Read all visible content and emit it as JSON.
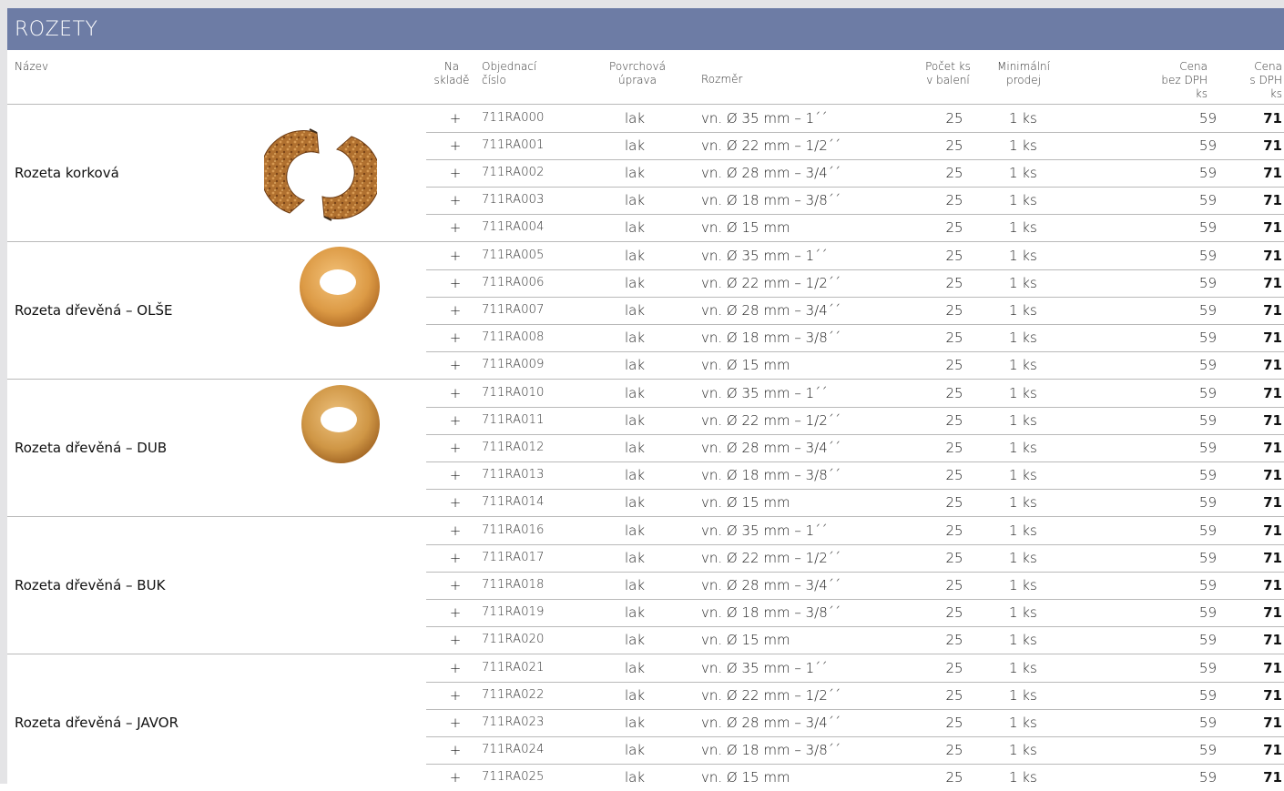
{
  "title": "ROZETY",
  "headers": {
    "name": "Název",
    "stock": [
      "Na",
      "skladě"
    ],
    "code": [
      "Objednací",
      "číslo"
    ],
    "finish": [
      "Povrchová",
      "úprava"
    ],
    "size": "Rozměr",
    "pack": [
      "Počet ks",
      "v balení"
    ],
    "min": [
      "Minimální",
      "prodej"
    ],
    "price": [
      "Cena",
      "bez DPH",
      "ks"
    ],
    "price_vat": [
      "Cena",
      "s DPH",
      "ks"
    ]
  },
  "groups": [
    {
      "name": "Rozeta korková",
      "image": "cork-rosette-image",
      "rows": [
        {
          "stock": "+",
          "code": "711RA000",
          "finish": "lak",
          "size": "vn. Ø 35 mm – 1´´",
          "pack": "25",
          "min": "1 ks",
          "price": "59",
          "price_vat": "71"
        },
        {
          "stock": "+",
          "code": "711RA001",
          "finish": "lak",
          "size": "vn. Ø 22 mm – 1/2´´",
          "pack": "25",
          "min": "1 ks",
          "price": "59",
          "price_vat": "71"
        },
        {
          "stock": "+",
          "code": "711RA002",
          "finish": "lak",
          "size": "vn. Ø 28 mm – 3/4´´",
          "pack": "25",
          "min": "1 ks",
          "price": "59",
          "price_vat": "71"
        },
        {
          "stock": "+",
          "code": "711RA003",
          "finish": "lak",
          "size": "vn. Ø 18 mm – 3/8´´",
          "pack": "25",
          "min": "1 ks",
          "price": "59",
          "price_vat": "71"
        },
        {
          "stock": "+",
          "code": "711RA004",
          "finish": "lak",
          "size": "vn. Ø 15 mm",
          "pack": "25",
          "min": "1 ks",
          "price": "59",
          "price_vat": "71"
        }
      ]
    },
    {
      "name": "Rozeta dřevěná – OLŠE",
      "image": "alder-rosette-image",
      "rows": [
        {
          "stock": "+",
          "code": "711RA005",
          "finish": "lak",
          "size": "vn. Ø 35 mm – 1´´",
          "pack": "25",
          "min": "1 ks",
          "price": "59",
          "price_vat": "71"
        },
        {
          "stock": "+",
          "code": "711RA006",
          "finish": "lak",
          "size": "vn. Ø 22 mm – 1/2´´",
          "pack": "25",
          "min": "1 ks",
          "price": "59",
          "price_vat": "71"
        },
        {
          "stock": "+",
          "code": "711RA007",
          "finish": "lak",
          "size": "vn. Ø 28 mm – 3/4´´",
          "pack": "25",
          "min": "1 ks",
          "price": "59",
          "price_vat": "71"
        },
        {
          "stock": "+",
          "code": "711RA008",
          "finish": "lak",
          "size": "vn. Ø 18 mm – 3/8´´",
          "pack": "25",
          "min": "1 ks",
          "price": "59",
          "price_vat": "71"
        },
        {
          "stock": "+",
          "code": "711RA009",
          "finish": "lak",
          "size": "vn. Ø 15 mm",
          "pack": "25",
          "min": "1 ks",
          "price": "59",
          "price_vat": "71"
        }
      ]
    },
    {
      "name": "Rozeta dřevěná – DUB",
      "image": "oak-rosette-image",
      "rows": [
        {
          "stock": "+",
          "code": "711RA010",
          "finish": "lak",
          "size": "vn. Ø 35 mm – 1´´",
          "pack": "25",
          "min": "1 ks",
          "price": "59",
          "price_vat": "71"
        },
        {
          "stock": "+",
          "code": "711RA011",
          "finish": "lak",
          "size": "vn. Ø 22 mm – 1/2´´",
          "pack": "25",
          "min": "1 ks",
          "price": "59",
          "price_vat": "71"
        },
        {
          "stock": "+",
          "code": "711RA012",
          "finish": "lak",
          "size": "vn. Ø 28 mm – 3/4´´",
          "pack": "25",
          "min": "1 ks",
          "price": "59",
          "price_vat": "71"
        },
        {
          "stock": "+",
          "code": "711RA013",
          "finish": "lak",
          "size": "vn. Ø 18 mm – 3/8´´",
          "pack": "25",
          "min": "1 ks",
          "price": "59",
          "price_vat": "71"
        },
        {
          "stock": "+",
          "code": "711RA014",
          "finish": "lak",
          "size": "vn. Ø 15 mm",
          "pack": "25",
          "min": "1 ks",
          "price": "59",
          "price_vat": "71"
        }
      ]
    },
    {
      "name": "Rozeta dřevěná – BUK",
      "image": "",
      "rows": [
        {
          "stock": "+",
          "code": "711RA016",
          "finish": "lak",
          "size": "vn. Ø 35 mm – 1´´",
          "pack": "25",
          "min": "1 ks",
          "price": "59",
          "price_vat": "71"
        },
        {
          "stock": "+",
          "code": "711RA017",
          "finish": "lak",
          "size": "vn. Ø 22 mm – 1/2´´",
          "pack": "25",
          "min": "1 ks",
          "price": "59",
          "price_vat": "71"
        },
        {
          "stock": "+",
          "code": "711RA018",
          "finish": "lak",
          "size": "vn. Ø 28 mm – 3/4´´",
          "pack": "25",
          "min": "1 ks",
          "price": "59",
          "price_vat": "71"
        },
        {
          "stock": "+",
          "code": "711RA019",
          "finish": "lak",
          "size": "vn. Ø 18 mm – 3/8´´",
          "pack": "25",
          "min": "1 ks",
          "price": "59",
          "price_vat": "71"
        },
        {
          "stock": "+",
          "code": "711RA020",
          "finish": "lak",
          "size": "vn. Ø 15 mm",
          "pack": "25",
          "min": "1 ks",
          "price": "59",
          "price_vat": "71"
        }
      ]
    },
    {
      "name": "Rozeta dřevěná – JAVOR",
      "image": "",
      "rows": [
        {
          "stock": "+",
          "code": "711RA021",
          "finish": "lak",
          "size": "vn. Ø 35 mm – 1´´",
          "pack": "25",
          "min": "1 ks",
          "price": "59",
          "price_vat": "71"
        },
        {
          "stock": "+",
          "code": "711RA022",
          "finish": "lak",
          "size": "vn. Ø 22 mm – 1/2´´",
          "pack": "25",
          "min": "1 ks",
          "price": "59",
          "price_vat": "71"
        },
        {
          "stock": "+",
          "code": "711RA023",
          "finish": "lak",
          "size": "vn. Ø 28 mm – 3/4´´",
          "pack": "25",
          "min": "1 ks",
          "price": "59",
          "price_vat": "71"
        },
        {
          "stock": "+",
          "code": "711RA024",
          "finish": "lak",
          "size": "vn. Ø 18 mm – 3/8´´",
          "pack": "25",
          "min": "1 ks",
          "price": "59",
          "price_vat": "71"
        },
        {
          "stock": "+",
          "code": "711RA025",
          "finish": "lak",
          "size": "vn. Ø 15 mm",
          "pack": "25",
          "min": "1 ks",
          "price": "59",
          "price_vat": "71"
        }
      ]
    }
  ],
  "colors": {
    "title_bar": "#6d7ca5",
    "page_frame": "#e4e4e6",
    "cork": "#a8692e",
    "wood_light": "#e0a24e"
  }
}
